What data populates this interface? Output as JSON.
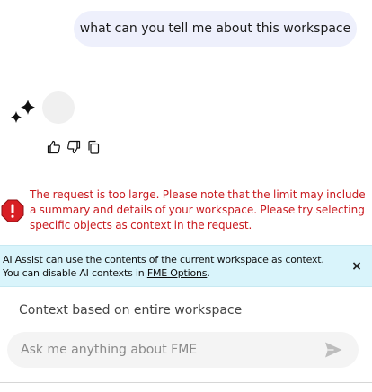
{
  "chat": {
    "user_message": "what can you tell me about this workspace",
    "assistant_icon": "sparkles-icon",
    "feedback": {
      "thumbs_up_icon": "thumbs-up-icon",
      "thumbs_down_icon": "thumbs-down-icon",
      "copy_icon": "copy-icon"
    },
    "error": {
      "icon": "error-octagon-icon",
      "color": "#c8191e",
      "message": "The request is too large. Please note that the limit may include a summary and details of your workspace. Please try selecting specific objects as context in the request."
    }
  },
  "info_banner": {
    "background": "#d9f4fb",
    "line1": "AI Assist can use the contents of the current workspace as context.",
    "line2_prefix": "You can disable AI contexts in ",
    "link_label": "FME Options",
    "line2_suffix": ".",
    "close_label": "×"
  },
  "context_label": "Context based on entire workspace",
  "input": {
    "value": "",
    "placeholder": "Ask me anything about FME",
    "send_icon": "send-icon"
  }
}
